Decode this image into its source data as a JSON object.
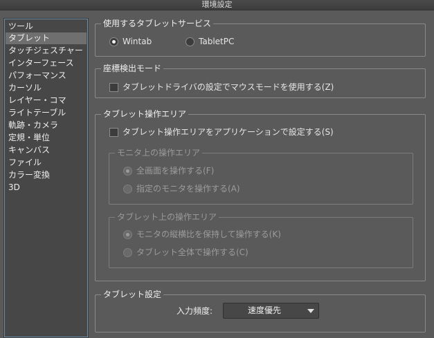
{
  "window": {
    "title": "環境設定"
  },
  "sidebar": {
    "items": [
      {
        "label": "ツール"
      },
      {
        "label": "タブレット",
        "selected": true
      },
      {
        "label": "タッチジェスチャー"
      },
      {
        "label": "インターフェース"
      },
      {
        "label": "パフォーマンス"
      },
      {
        "label": "カーソル"
      },
      {
        "label": "レイヤー・コマ"
      },
      {
        "label": "ライトテーブル"
      },
      {
        "label": "軌跡・カメラ"
      },
      {
        "label": "定規・単位"
      },
      {
        "label": "キャンバス"
      },
      {
        "label": "ファイル"
      },
      {
        "label": "カラー変換"
      },
      {
        "label": "3D"
      }
    ]
  },
  "tablet_service": {
    "title": "使用するタブレットサービス",
    "wintab": "Wintab",
    "tabletpc": "TabletPC",
    "selected": "Wintab"
  },
  "coordinate_mode": {
    "title": "座標検出モード",
    "mouse_mode": "タブレットドライバの設定でマウスモードを使用する(Z)"
  },
  "operation_area": {
    "title": "タブレット操作エリア",
    "set_in_app": "タブレット操作エリアをアプリケーションで設定する(S)",
    "monitor_area": {
      "title": "モニタ上の操作エリア",
      "full_screen": "全画面を操作する(F)",
      "specified_monitor": "指定のモニタを操作する(A)"
    },
    "tablet_area": {
      "title": "タブレット上の操作エリア",
      "keep_ratio": "モニタの縦横比を保持して操作する(K)",
      "whole_tablet": "タブレット全体で操作する(C)"
    }
  },
  "tablet_settings": {
    "title": "タブレット設定",
    "input_frequency_label": "入力頻度:",
    "input_frequency_value": "速度優先"
  }
}
